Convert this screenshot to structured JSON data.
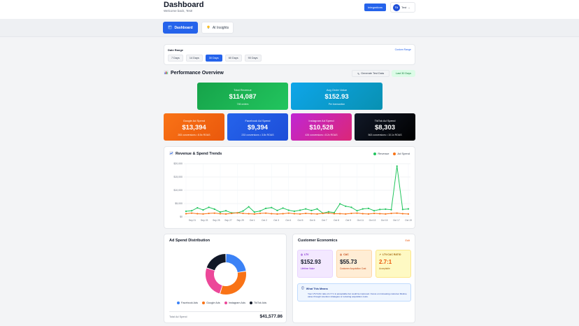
{
  "header": {
    "title": "Dashboard",
    "subtitle": "Welcome back, Test!",
    "integrations_label": "Integrations",
    "user": {
      "initials": "TU",
      "name": "Test"
    }
  },
  "tabs": [
    {
      "label": "Dashboard",
      "icon": "bar-chart-icon",
      "active": true
    },
    {
      "label": "AI Insights",
      "icon": "lightbulb-icon",
      "active": false
    }
  ],
  "date_range": {
    "label": "Date Range",
    "custom_label": "Custom Range",
    "options": [
      "7 Days",
      "14 Days",
      "30 Days",
      "60 Days",
      "90 Days"
    ],
    "selected": "30 Days"
  },
  "overview": {
    "title": "Performance Overview",
    "generate_label": "Generate Test Data",
    "range_badge": "Last 30 Days"
  },
  "metrics": {
    "revenue": {
      "label": "Total Revenue",
      "value": "$114,087",
      "sub": "746 orders"
    },
    "aov": {
      "label": "Avg Order Value",
      "value": "$152.93",
      "sub": "Per transaction"
    },
    "google": {
      "label": "Google Ad Spend",
      "value": "$13,394",
      "sub": "283 conversions • 8.5x ROAS"
    },
    "facebook": {
      "label": "Facebook Ad Spend",
      "value": "$9,394",
      "sub": "233 conversions • 3.8x ROAS"
    },
    "instagram": {
      "label": "Instagram Ad Spend",
      "value": "$10,528",
      "sub": "426 conversions • 8.2x ROAS"
    },
    "tiktok": {
      "label": "TikTok Ad Spend",
      "value": "$8,303",
      "sub": "563 conversions • 10.1x ROAS"
    }
  },
  "trends": {
    "title": "Revenue & Spend Trends",
    "legend": {
      "revenue": "Revenue",
      "spend": "Ad Spend"
    }
  },
  "chart_data": {
    "type": "line",
    "title": "Revenue & Spend Trends",
    "ylim": [
      0,
      20000
    ],
    "yticks": [
      "$0",
      "$5,000",
      "$10,000",
      "$15,000",
      "$20,000"
    ],
    "xtick_labels": [
      "Sep 21",
      "Sep 23",
      "Sep 25",
      "Sep 27",
      "Sep 29",
      "Oct 1",
      "Oct 2",
      "Oct 3",
      "Oct 4",
      "Oct 5",
      "Oct 6",
      "Oct 7",
      "Oct 8",
      "Oct 9",
      "Oct 11",
      "Oct 13",
      "Oct 15",
      "Oct 17",
      "Oct 19"
    ],
    "colors": {
      "revenue": "#22c55e",
      "spend": "#f97316"
    },
    "series": [
      {
        "name": "Revenue",
        "values": [
          2100,
          2300,
          3400,
          2600,
          3600,
          2900,
          1800,
          2300,
          1500,
          1500,
          2200,
          3800,
          1800,
          2200,
          3200,
          3500,
          2400,
          3300,
          2500,
          2100,
          2500,
          3000,
          2400,
          3000,
          1400,
          1900,
          1600,
          4900,
          4000,
          3600,
          2300,
          3000,
          3200,
          2300,
          2800,
          2900,
          2700,
          19100,
          2800,
          3000
        ]
      },
      {
        "name": "Ad Spend",
        "values": [
          1200,
          1400,
          1200,
          1100,
          1300,
          1400,
          1200,
          1100,
          1300,
          1500,
          1300,
          1200,
          1100,
          1300,
          1400,
          1200,
          1100,
          1200,
          1400,
          1200,
          1100,
          1300,
          1200,
          1100,
          1300,
          1400,
          1200,
          1200,
          1100,
          1300,
          1400,
          1200,
          1100,
          1300,
          1200,
          1100,
          1300,
          1400,
          1200,
          1100
        ]
      }
    ]
  },
  "spend_distribution": {
    "title": "Ad Spend Distribution",
    "legend": [
      "Facebook Ads",
      "Google Ads",
      "Instagram Ads",
      "TikTok Ads"
    ],
    "values": [
      9394,
      13394,
      10528,
      8303
    ],
    "colors": [
      "#3b82f6",
      "#f97316",
      "#ec4899",
      "#111827"
    ],
    "total_label": "Total Ad Spend",
    "total_value": "$41,577.86"
  },
  "economics": {
    "title": "Customer Economics",
    "export_label": "Edit",
    "ltv": {
      "label": "LTV",
      "value": "$152.93",
      "sub": "Lifetime Value"
    },
    "cac": {
      "label": "CAC",
      "value": "$55.73",
      "sub": "Customer Acquisition Cost"
    },
    "ratio": {
      "label": "LTV:CAC RATIO",
      "value": "2.7:1",
      "sub": "Acceptable"
    },
    "means_title": "What This Means",
    "means_text": "Your LTV:CAC ratio of 2.7:1 is acceptable but could be improved. Focus on increasing customer lifetime value through retention strategies or reducing acquisition costs."
  }
}
